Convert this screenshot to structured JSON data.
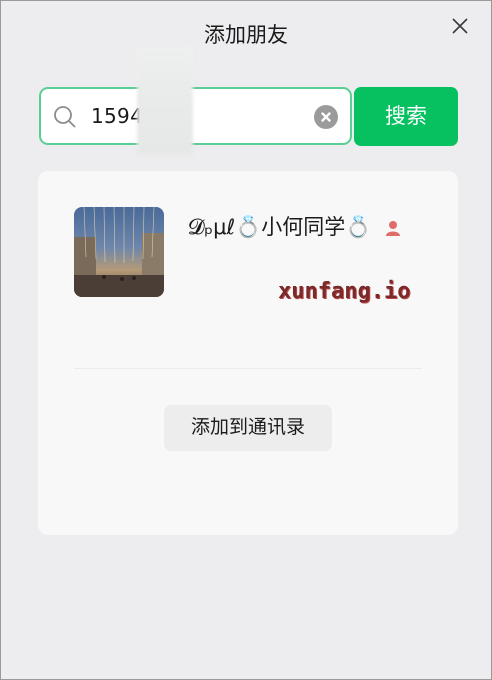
{
  "window": {
    "title": "添加朋友"
  },
  "search": {
    "value": "1594    080",
    "button_label": "搜索"
  },
  "result": {
    "nickname": "𝓓ₚμℓ💍小何同学💍",
    "gender": "female",
    "watermark": "xunfang.io",
    "add_button_label": "添加到通讯录"
  },
  "colors": {
    "accent": "#07c160",
    "focus_border": "#5ccd94",
    "gender_female": "#e06c6c"
  },
  "icons": {
    "close": "close-icon",
    "search": "search-icon",
    "clear": "clear-icon",
    "gender": "female-icon"
  }
}
